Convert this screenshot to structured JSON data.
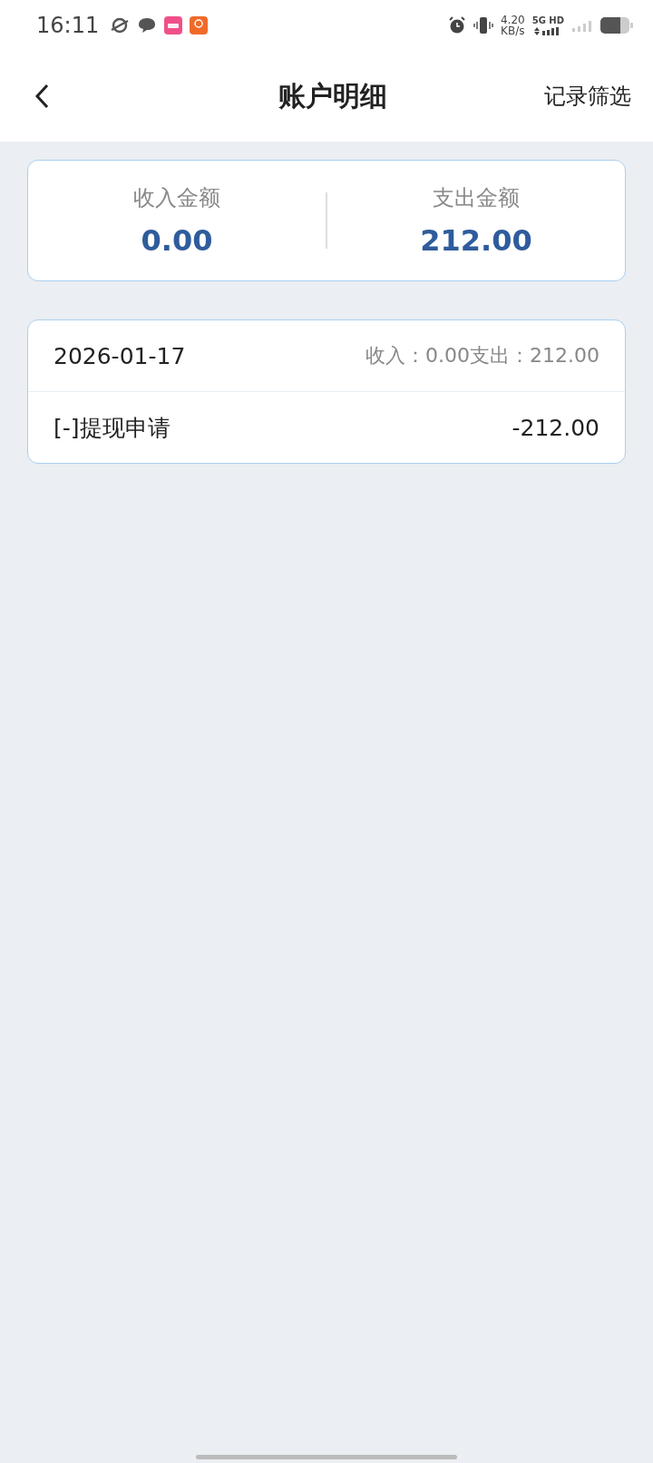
{
  "status_bar": {
    "time": "16:11",
    "speed_value": "4.20",
    "speed_unit": "KB/s",
    "network": "5G HD"
  },
  "header": {
    "title": "账户明细",
    "action": "记录筛选"
  },
  "summary": [
    {
      "label": "收入金额",
      "amount": "0.00"
    },
    {
      "label": "支出金额",
      "amount": "212.00"
    }
  ],
  "days": [
    {
      "date": "2026-01-17",
      "totals": "收入：0.00支出：212.00",
      "records": [
        {
          "title": "[-]提现申请",
          "amount": "-212.00"
        }
      ]
    }
  ]
}
